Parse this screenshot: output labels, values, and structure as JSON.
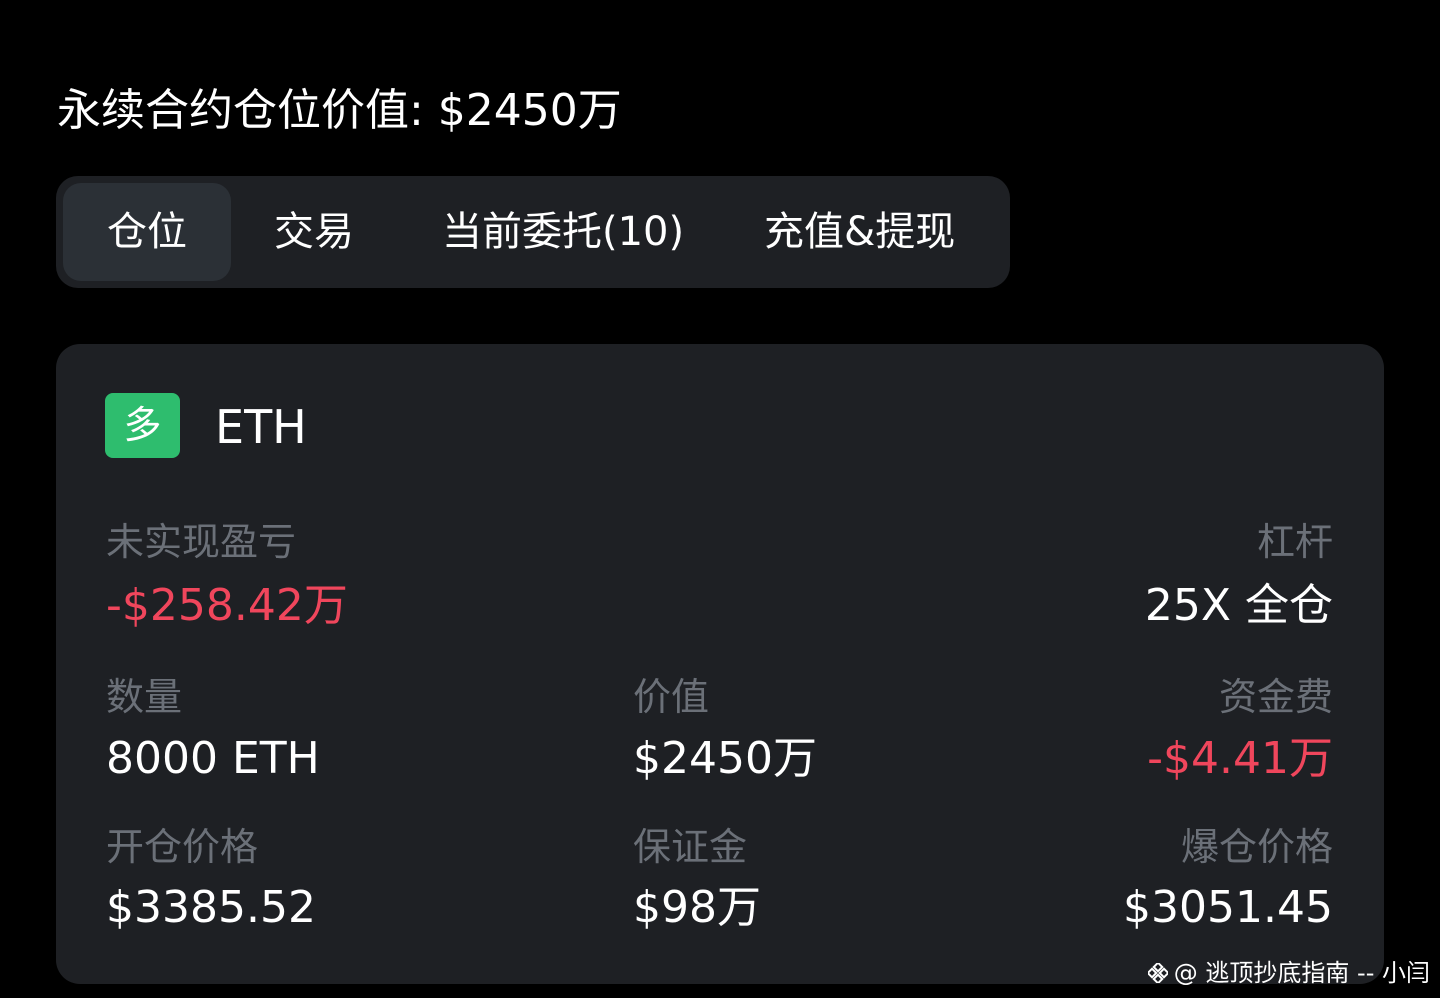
{
  "header": {
    "title": "永续合约仓位价值: $2450万"
  },
  "tabs": [
    {
      "label": "仓位",
      "active": true
    },
    {
      "label": "交易",
      "active": false
    },
    {
      "label": "当前委托(10)",
      "active": false
    },
    {
      "label": "充值&提现",
      "active": false
    }
  ],
  "position": {
    "side_badge": "多",
    "symbol": "ETH",
    "unrealized_pnl_label": "未实现盈亏",
    "unrealized_pnl_value": "-$258.42万",
    "leverage_label": "杠杆",
    "leverage_value": "25X 全仓",
    "quantity_label": "数量",
    "quantity_value": "8000 ETH",
    "value_label": "价值",
    "value_value": "$2450万",
    "funding_fee_label": "资金费",
    "funding_fee_value": "-$4.41万",
    "entry_price_label": "开仓价格",
    "entry_price_value": "$3385.52",
    "margin_label": "保证金",
    "margin_value": "$98万",
    "liq_price_label": "爆仓价格",
    "liq_price_value": "$3051.45"
  },
  "watermark": {
    "icon": "binance-logo-icon",
    "text": "@ 逃顶抄底指南 -- 小闫"
  },
  "colors": {
    "background": "#000000",
    "card": "#1e2024",
    "active_tab": "#2b3036",
    "long_badge": "#2ebd6e",
    "negative": "#f0465c",
    "label": "#6b7078"
  }
}
